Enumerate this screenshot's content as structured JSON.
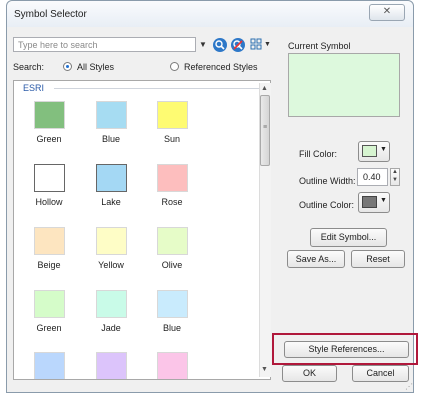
{
  "window": {
    "title": "Symbol Selector",
    "close_glyph": "✕"
  },
  "search": {
    "placeholder": "Type here to search",
    "label": "Search:",
    "option_all": "All Styles",
    "option_referenced": "Referenced Styles",
    "selected": "All Styles"
  },
  "gallery": {
    "group": "ESRI",
    "symbols": [
      {
        "label": "Green",
        "fill": "#82bf7e"
      },
      {
        "label": "Blue",
        "fill": "#a6dcf2"
      },
      {
        "label": "Sun",
        "fill": "#fefb72"
      },
      {
        "label": "Hollow",
        "fill": "#ffffff"
      },
      {
        "label": "Lake",
        "fill": "#a4d8f4"
      },
      {
        "label": "Rose",
        "fill": "#fdbebe"
      },
      {
        "label": "Beige",
        "fill": "#fde5c0"
      },
      {
        "label": "Yellow",
        "fill": "#fefdc6"
      },
      {
        "label": "Olive",
        "fill": "#e6fcc8"
      },
      {
        "label": "Green",
        "fill": "#d5fcc9"
      },
      {
        "label": "Jade",
        "fill": "#c9fbe8"
      },
      {
        "label": "Blue",
        "fill": "#c9ebfd"
      },
      {
        "label": "",
        "fill": "#bad7fd"
      },
      {
        "label": "",
        "fill": "#dcc4fb"
      },
      {
        "label": "",
        "fill": "#fbc5e8"
      }
    ]
  },
  "current_symbol": {
    "heading": "Current Symbol",
    "preview_fill": "#ddf9dd",
    "fill_color_label": "Fill Color:",
    "fill_color": "#d6f4d0",
    "outline_width_label": "Outline Width:",
    "outline_width": "0.40",
    "outline_color_label": "Outline Color:",
    "outline_color": "#777777"
  },
  "buttons": {
    "edit_symbol": "Edit Symbol...",
    "save_as": "Save As...",
    "reset": "Reset",
    "style_references": "Style References...",
    "ok": "OK",
    "cancel": "Cancel"
  },
  "icons": [
    "search-icon",
    "clear-search-icon",
    "view-options-icon",
    "dropdown-arrow-icon",
    "scroll-up-icon",
    "scroll-down-icon",
    "resize-grip-icon"
  ],
  "highlight_color": "#b0183b"
}
